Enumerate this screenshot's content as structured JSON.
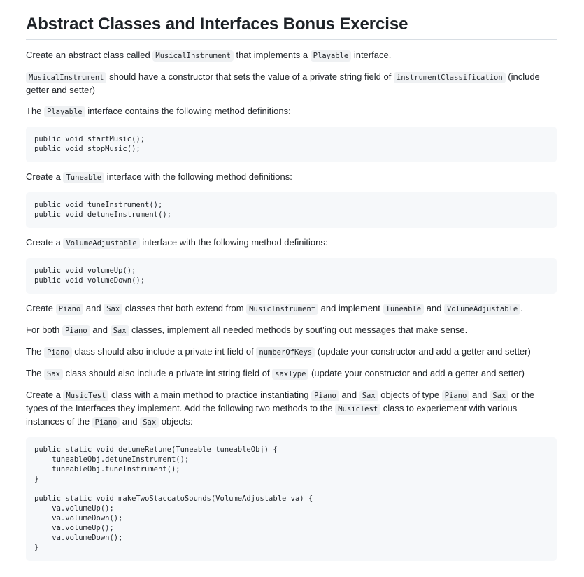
{
  "title": "Abstract Classes and Interfaces Bonus Exercise",
  "p1": {
    "t1": "Create an abstract class called ",
    "c1": "MusicalInstrument",
    "t2": " that implements a ",
    "c2": "Playable",
    "t3": " interface."
  },
  "p2": {
    "c1": "MusicalInstrument",
    "t1": " should have a constructor that sets the value of a private string field of ",
    "c2": "instrumentClassification",
    "t2": " (include getter and setter)"
  },
  "p3": {
    "t1": "The ",
    "c1": "Playable",
    "t2": " interface contains the following method definitions:"
  },
  "code1": "public void startMusic();\npublic void stopMusic();",
  "p4": {
    "t1": "Create a ",
    "c1": "Tuneable",
    "t2": " interface with the following method definitions:"
  },
  "code2": "public void tuneInstrument();\npublic void detuneInstrument();",
  "p5": {
    "t1": "Create a ",
    "c1": "VolumeAdjustable",
    "t2": " interface with the following method definitions:"
  },
  "code3": "public void volumeUp();\npublic void volumeDown();",
  "p6": {
    "t1": "Create ",
    "c1": "Piano",
    "t2": " and ",
    "c2": "Sax",
    "t3": " classes that both extend from ",
    "c3": "MusicInstrument",
    "t4": " and implement ",
    "c4": "Tuneable",
    "t5": " and ",
    "c5": "VolumeAdjustable",
    "t6": "."
  },
  "p7": {
    "t1": "For both ",
    "c1": "Piano",
    "t2": " and ",
    "c2": "Sax",
    "t3": " classes, implement all needed methods by sout'ing out messages that make sense."
  },
  "p8": {
    "t1": "The ",
    "c1": "Piano",
    "t2": " class should also include a private int field of ",
    "c2": "numberOfKeys",
    "t3": " (update your constructor and add a getter and setter)"
  },
  "p9": {
    "t1": "The ",
    "c1": "Sax",
    "t2": " class should also include a private int string field of ",
    "c2": "saxType",
    "t3": " (update your constructor and add a getter and setter)"
  },
  "p10": {
    "t1": "Create a ",
    "c1": "MusicTest",
    "t2": " class with a main method to practice instantiating ",
    "c2": "Piano",
    "t3": " and ",
    "c3": "Sax",
    "t4": " objects of type ",
    "c4": "Piano",
    "t5": " and ",
    "c5": "Sax",
    "t6": " or the types of the Interfaces they implement. Add the following two methods to the ",
    "c6": "MusicTest",
    "t7": " class to experiement with various instances of the ",
    "c7": "Piano",
    "t8": " and ",
    "c8": "Sax",
    "t9": " objects:"
  },
  "code4": "public static void detuneRetune(Tuneable tuneableObj) {\n    tuneableObj.detuneInstrument();\n    tuneableObj.tuneInstrument();\n}\n\npublic static void makeTwoStaccatoSounds(VolumeAdjustable va) {\n    va.volumeUp();\n    va.volumeDown();\n    va.volumeUp();\n    va.volumeDown();\n}"
}
